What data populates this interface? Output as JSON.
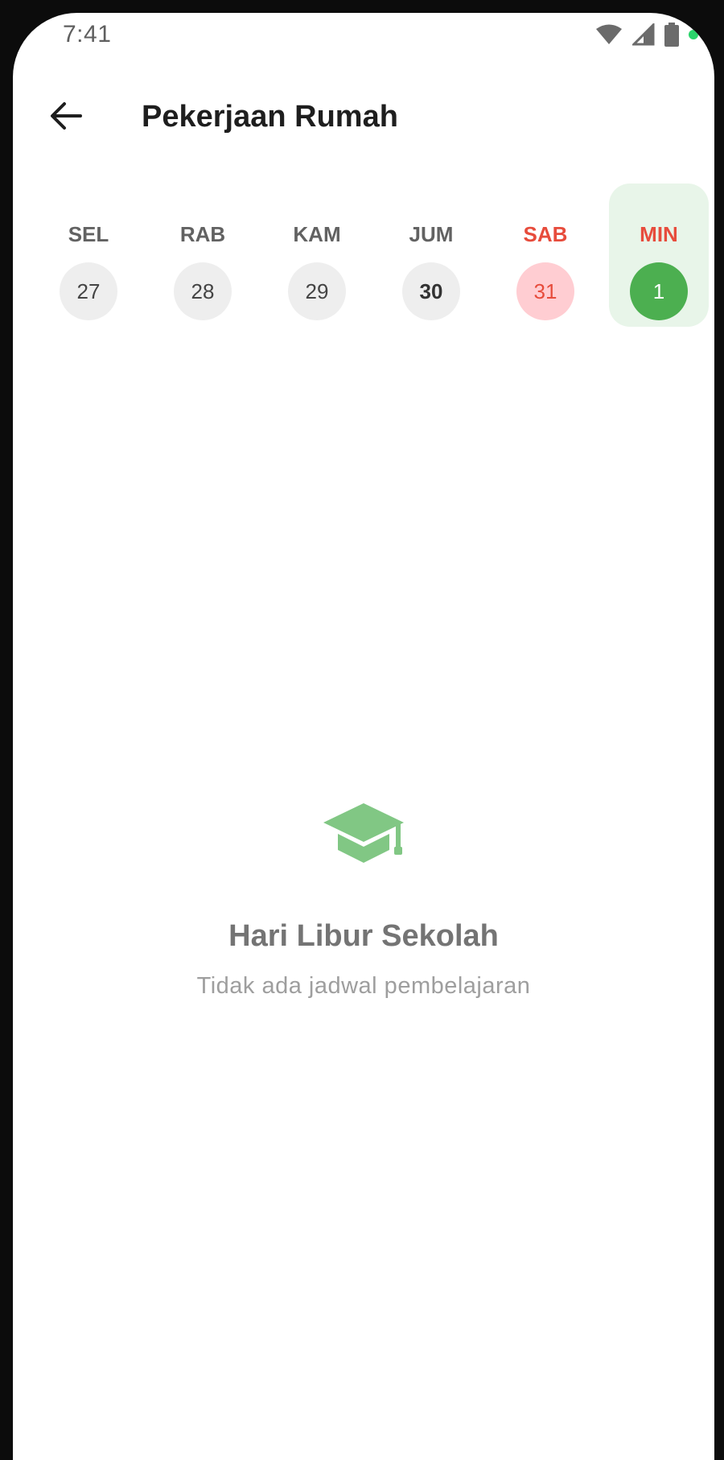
{
  "status_bar": {
    "time": "7:41",
    "icons": [
      "wifi-icon",
      "cellular-signal-icon",
      "battery-icon",
      "privacy-indicator-dot"
    ]
  },
  "app_bar": {
    "back_icon": "arrow-left-icon",
    "title": "Pekerjaan Rumah"
  },
  "days": [
    {
      "name": "SEL",
      "number": "27",
      "state": "normal"
    },
    {
      "name": "RAB",
      "number": "28",
      "state": "normal"
    },
    {
      "name": "KAM",
      "number": "29",
      "state": "normal"
    },
    {
      "name": "JUM",
      "number": "30",
      "state": "today"
    },
    {
      "name": "SAB",
      "number": "31",
      "state": "weekend"
    },
    {
      "name": "MIN",
      "number": "1",
      "state": "selected"
    }
  ],
  "empty_state": {
    "icon": "graduation-cap-icon",
    "title": "Hari Libur Sekolah",
    "subtitle": "Tidak ada jadwal pembelajaran"
  },
  "colors": {
    "accent_green": "#4caf50",
    "icon_green": "#81c784",
    "selected_bg": "#e8f5e9",
    "weekend_red": "#e74c3c",
    "weekend_bg": "#ffcdd2"
  }
}
